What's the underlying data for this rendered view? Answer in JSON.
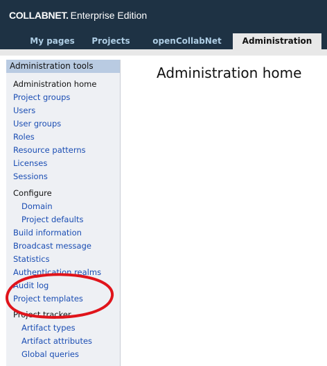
{
  "header": {
    "brand_bold": "COLLABNET.",
    "brand_rest": "Enterprise Edition"
  },
  "tabs": [
    {
      "label": "My pages",
      "active": false
    },
    {
      "label": "Projects",
      "active": false
    },
    {
      "label": "openCollabNet",
      "active": false
    },
    {
      "label": "Administration",
      "active": true
    }
  ],
  "sidebar": {
    "header": "Administration tools",
    "items": [
      {
        "label": "Administration home",
        "kind": "plain"
      },
      {
        "label": "Project groups",
        "kind": "link"
      },
      {
        "label": "Users",
        "kind": "link"
      },
      {
        "label": "User groups",
        "kind": "link"
      },
      {
        "label": "Roles",
        "kind": "link"
      },
      {
        "label": "Resource patterns",
        "kind": "link"
      },
      {
        "label": "Licenses",
        "kind": "link"
      },
      {
        "label": "Sessions",
        "kind": "link"
      },
      {
        "label": "Configure",
        "kind": "plain"
      },
      {
        "label": "Domain",
        "kind": "sub"
      },
      {
        "label": "Project defaults",
        "kind": "sub"
      },
      {
        "label": "Build information",
        "kind": "link"
      },
      {
        "label": "Broadcast message",
        "kind": "link"
      },
      {
        "label": "Statistics",
        "kind": "link"
      },
      {
        "label": "Authentication realms",
        "kind": "link"
      },
      {
        "label": "Audit log",
        "kind": "link"
      },
      {
        "label": "Project templates",
        "kind": "link"
      },
      {
        "label": "Project tracker",
        "kind": "plain"
      },
      {
        "label": "Artifact types",
        "kind": "sub"
      },
      {
        "label": "Artifact attributes",
        "kind": "sub"
      },
      {
        "label": "Global queries",
        "kind": "sub"
      }
    ]
  },
  "main": {
    "title": "Administration home"
  },
  "colors": {
    "topbar": "#1e3244",
    "tab_text": "#aecde4",
    "link": "#1a4db3",
    "sidebar_header": "#b9cbe2",
    "annotation": "#e0141b"
  }
}
